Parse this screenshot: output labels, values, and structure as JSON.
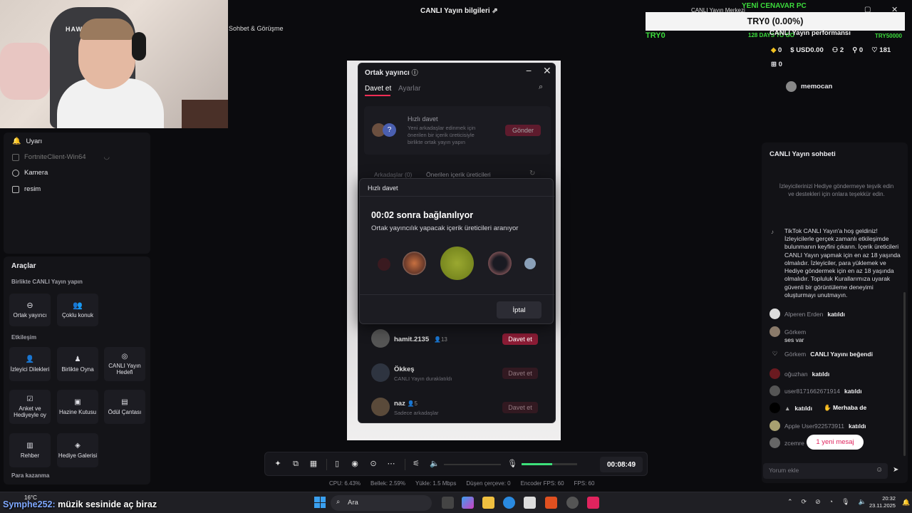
{
  "overlay": {
    "sohbet_label": "Sohbet & Görüşme",
    "stream_info": "CANLI Yayın bilgileri",
    "try_bar": "TRY0 (0.00%)",
    "try_left": "TRY0",
    "try_right": "TRY50000",
    "days": "128 DAYS TO GO",
    "cenavar": "YENİ CENAVAR PC",
    "music_user": "Symphe252:",
    "music_text": " müzik sesinide aç biraz",
    "webcam_logo": "HAWK"
  },
  "sources": {
    "items": [
      {
        "label": "Uyarı",
        "icon": "bell-icon"
      },
      {
        "label": "FortniteClient-Win64",
        "icon": "window-icon"
      },
      {
        "label": "Kamera",
        "icon": "camera-icon"
      },
      {
        "label": "resim",
        "icon": "image-icon"
      }
    ]
  },
  "tools": {
    "title": "Araçlar",
    "sections": [
      {
        "title": "Birlikte CANLI Yayın yapın"
      },
      {
        "title": "Etkileşim"
      },
      {
        "title": "Para kazanma"
      }
    ],
    "items": [
      {
        "label": "Ortak yayıncı"
      },
      {
        "label": "Çoklu konuk"
      },
      {
        "label": "İzleyici Dilekleri"
      },
      {
        "label": "Birlikte Oyna"
      },
      {
        "label": "CANLI Yayın Hedefi"
      },
      {
        "label": "Anket ve Hediyeyle oy"
      },
      {
        "label": "Hazine Kutusu"
      },
      {
        "label": "Ödül Çantası"
      },
      {
        "label": "Rehber"
      },
      {
        "label": "Hediye Galerisi"
      }
    ]
  },
  "cohost": {
    "title": "Ortak yayıncı",
    "tabs": [
      "Davet et",
      "Ayarlar"
    ],
    "quick_title": "Hızlı davet",
    "quick_desc": "Yeni arkadaşlar edinmek için önerilen bir içerik üreticisiyle birlikte ortak yayın yapın",
    "send_label": "Gönder",
    "friends_tab": "Arkadaşlar (0)",
    "suggested_tab": "Önerilen içerik üreticileri",
    "rows": [
      {
        "name": "hamit.2135",
        "count": "13",
        "sub": "",
        "button": "Davet et"
      },
      {
        "name": "Ökkeş",
        "count": "",
        "sub": "CANLI Yayın duraklatıldı",
        "button": "Davet et"
      },
      {
        "name": "naz",
        "count": "5",
        "sub": "Sadece arkadaşlar",
        "button": "Davet et"
      }
    ]
  },
  "quick_modal": {
    "header": "Hızlı davet",
    "title": "00:02 sonra bağlanılıyor",
    "subtitle": "Ortak yayıncılık yapacak içerik üreticileri aranıyor",
    "cancel": "İptal"
  },
  "toolbar": {
    "timer": "00:08:49",
    "mic_level": 0.55
  },
  "stats": {
    "cpu": "CPU: 6.43%",
    "memory": "Bellek: 2.59%",
    "upload": "Yükle: 1.5 Mbps",
    "dropped": "Düşen çerçeve: 0",
    "encoder_fps": "Encoder FPS: 60",
    "fps": "FPS: 60"
  },
  "performance": {
    "title": "CANLI Yayın performansı",
    "diamonds": "0",
    "usd": "USD0.00",
    "viewers": "2",
    "followers": "0",
    "likes": "181",
    "gifts": "0",
    "viewer_name": "memocan",
    "top_window_label": "CANLI Yayın Merkezi"
  },
  "chat": {
    "title": "CANLI Yayın sohbeti",
    "hint": "İzleyicilerinizi Hediye göndermeye teşvik edin ve destekleri için onlara teşekkür edin.",
    "welcome": "TikTok CANLI Yayın'a hoş geldiniz! İzleyicilerle gerçek zamanlı etkileşimde bulunmanın keyfini çıkarın. İçerik üreticileri CANLI Yayın yapmak için en az 18 yaşında olmalıdır. İzleyiciler, para yüklemek ve Hediye göndermek için en az 18 yaşında olmalıdır. Topluluk Kurallarımıza uyarak güvenli bir görüntüleme deneyimi oluşturmayı unutmayın.",
    "messages": [
      {
        "user": "Alperen Erden",
        "text": "katıldı"
      },
      {
        "user": "Görkem",
        "text": "ses var"
      },
      {
        "user": "Görkem",
        "text": "CANLI Yayını beğendi"
      },
      {
        "user": "oğuzhan",
        "text": "katıldı"
      },
      {
        "user": "user8171662671914",
        "text": "katıldı"
      },
      {
        "user": "",
        "text": "katıldı",
        "extra": "Merhaba de"
      },
      {
        "user": "Apple User922573911",
        "text": "katıldı"
      },
      {
        "user": "zcemre",
        "text": ""
      }
    ],
    "new_message": "1 yeni mesaj",
    "comment_placeholder": "Yorum ekle"
  },
  "taskbar": {
    "search": "Ara",
    "weather": "16°C",
    "time": "20:32",
    "date": "23.11.2025"
  }
}
